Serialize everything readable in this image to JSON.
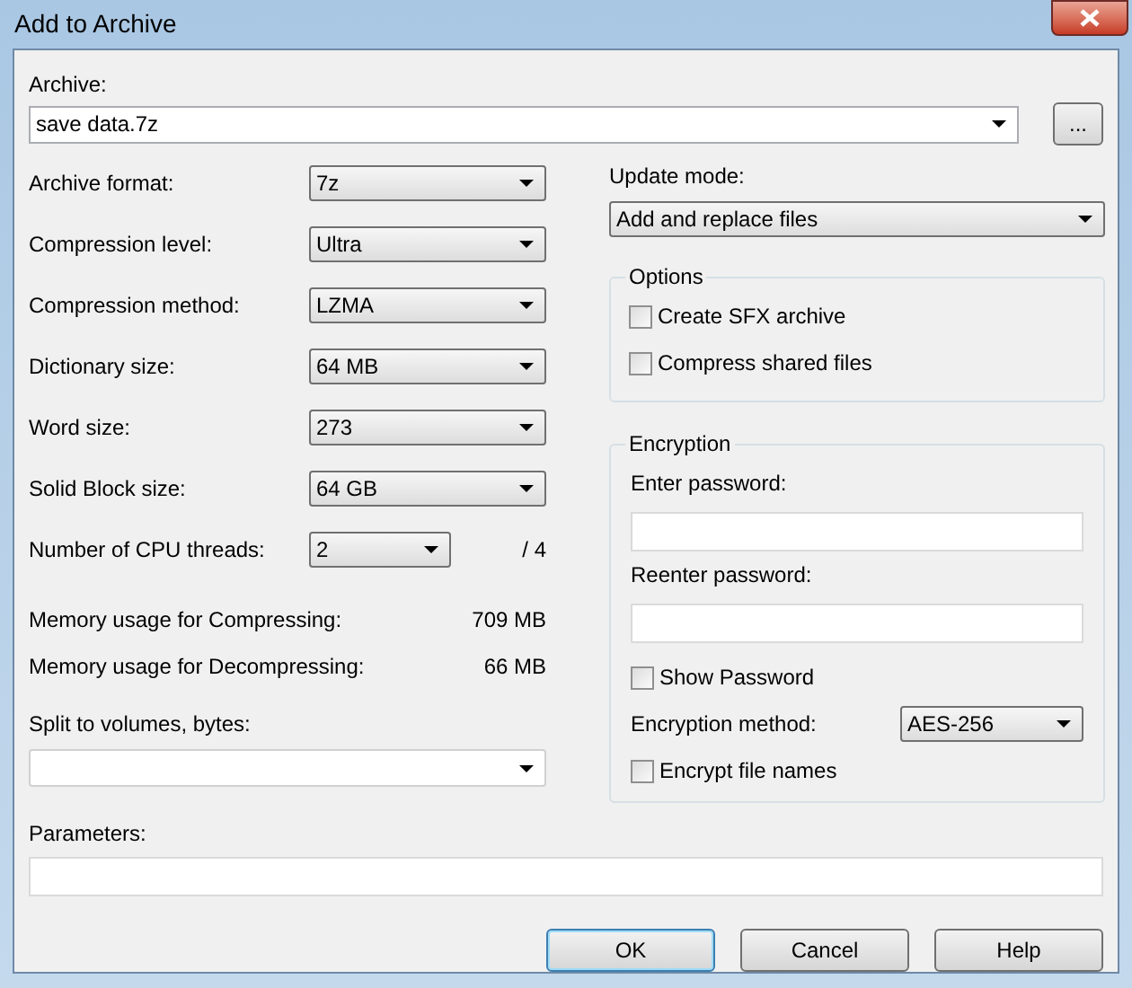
{
  "window": {
    "title": "Add to Archive"
  },
  "archive": {
    "label": "Archive:",
    "value": "save data.7z",
    "browse": "..."
  },
  "settings": [
    {
      "kind": "select",
      "label": "Archive format:",
      "value": "7z"
    },
    {
      "kind": "select",
      "label": "Compression level:",
      "value": "Ultra"
    },
    {
      "kind": "select",
      "label": "Compression method:",
      "value": "LZMA"
    },
    {
      "kind": "select",
      "label": "Dictionary size:",
      "value": "64 MB"
    },
    {
      "kind": "select",
      "label": "Word size:",
      "value": "273"
    },
    {
      "kind": "select",
      "label": "Solid Block size:",
      "value": "64 GB"
    },
    {
      "kind": "short_select",
      "label": "Number of CPU threads:",
      "value": "2",
      "suffix": "/ 4"
    }
  ],
  "memory": [
    {
      "label": "Memory usage for Compressing:",
      "value": "709 MB"
    },
    {
      "label": "Memory usage for Decompressing:",
      "value": "66 MB"
    }
  ],
  "split": {
    "label": "Split to volumes, bytes:"
  },
  "update_mode": {
    "label": "Update mode:",
    "value": "Add and replace files"
  },
  "options": {
    "title": "Options",
    "items": [
      {
        "label": "Create SFX archive",
        "checked": false
      },
      {
        "label": "Compress shared files",
        "checked": false
      }
    ]
  },
  "encryption": {
    "title": "Encryption",
    "fields": [
      {
        "label": "Enter password:"
      },
      {
        "label": "Reenter password:"
      }
    ],
    "show_password": {
      "label": "Show Password",
      "checked": false
    },
    "method": {
      "label": "Encryption method:",
      "value": "AES-256"
    },
    "encrypt_names": {
      "label": "Encrypt file names",
      "checked": false
    }
  },
  "parameters": {
    "label": "Parameters:"
  },
  "buttons": [
    {
      "label": "OK",
      "default": true
    },
    {
      "label": "Cancel",
      "default": false
    },
    {
      "label": "Help",
      "default": false
    }
  ]
}
